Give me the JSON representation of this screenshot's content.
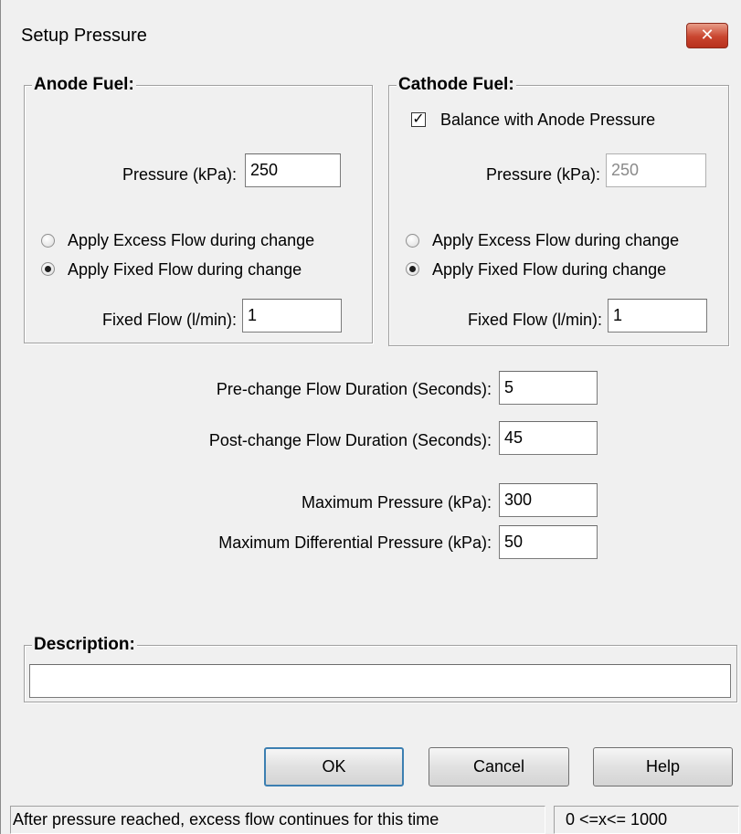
{
  "window": {
    "title": "Setup Pressure",
    "close_glyph": "✕"
  },
  "anode": {
    "title": "Anode Fuel:",
    "pressure_label": "Pressure (kPa):",
    "pressure_value": "250",
    "radio_excess_label": "Apply Excess Flow during change",
    "radio_fixed_label": "Apply Fixed Flow during change",
    "selected_radio": "fixed",
    "fixed_flow_label": "Fixed Flow (l/min):",
    "fixed_flow_value": "1"
  },
  "cathode": {
    "title": "Cathode Fuel:",
    "balance_label": "Balance with Anode Pressure",
    "balance_checked": true,
    "pressure_label": "Pressure (kPa):",
    "pressure_value": "250",
    "radio_excess_label": "Apply Excess Flow during change",
    "radio_fixed_label": "Apply Fixed Flow during change",
    "selected_radio": "fixed",
    "fixed_flow_label": "Fixed Flow (l/min):",
    "fixed_flow_value": "1"
  },
  "settings": {
    "pre_change_label": "Pre-change Flow Duration (Seconds):",
    "pre_change_value": "5",
    "post_change_label": "Post-change Flow Duration (Seconds):",
    "post_change_value": "45",
    "max_pressure_label": "Maximum Pressure (kPa):",
    "max_pressure_value": "300",
    "max_diff_label": "Maximum Differential Pressure (kPa):",
    "max_diff_value": "50"
  },
  "description": {
    "title": "Description:",
    "value": ""
  },
  "buttons": {
    "ok": "OK",
    "cancel": "Cancel",
    "help": "Help"
  },
  "status": {
    "hint": "After pressure reached, excess flow continues for this time",
    "range": "0 <=x<= 1000"
  }
}
